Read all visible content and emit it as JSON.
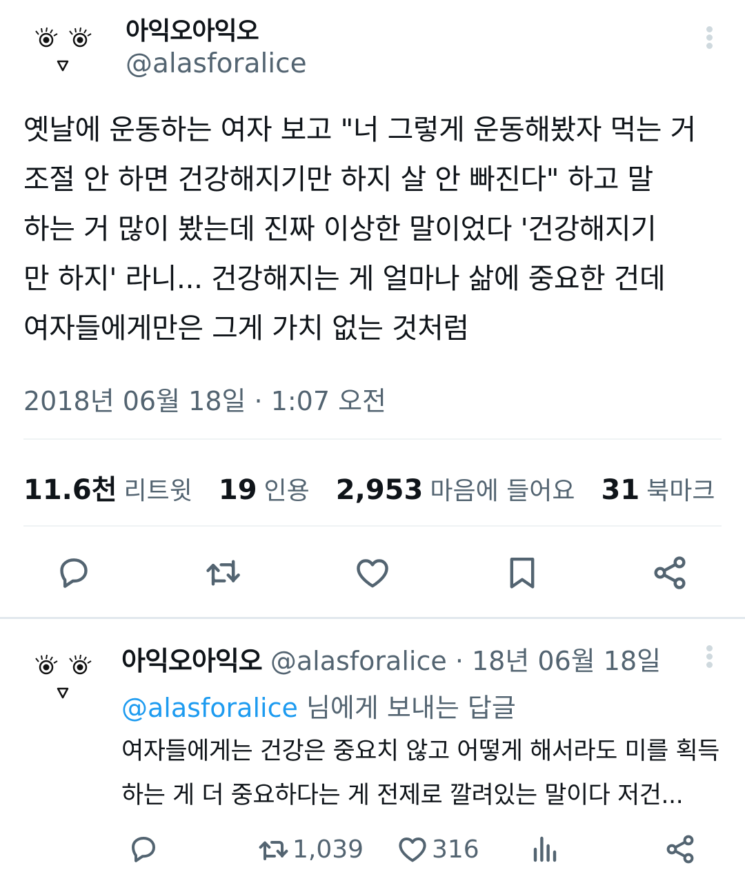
{
  "tweet": {
    "display_name": "아익오아익오",
    "handle": "@alasforalice",
    "body_lines": [
      "옛날에 운동하는 여자 보고 \"너 그렇게 운동해봤자 먹는 거",
      "조절 안 하면 건강해지기만 하지 살 안 빠진다\" 하고 말",
      "하는 거 많이 봤는데 진짜 이상한 말이었다 '건강해지기",
      "만 하지' 라니... 건강해지는 게 얼마나 삶에 중요한 건데",
      "여자들에게만은 그게 가치 없는 것처럼"
    ],
    "timestamp": "2018년 06월 18일 · 1:07 오전",
    "stats": {
      "retweets": {
        "count": "11.6천",
        "label": "리트윗"
      },
      "quotes": {
        "count": "19",
        "label": "인용"
      },
      "likes": {
        "count": "2,953",
        "label": "마음에 들어요"
      },
      "bookmarks": {
        "count": "31",
        "label": "북마크"
      }
    },
    "action_icons": [
      "reply-icon",
      "retweet-icon",
      "like-icon",
      "bookmark-icon",
      "share-icon"
    ]
  },
  "reply": {
    "display_name": "아익오아익오",
    "handle": "@alasforalice",
    "separator": "·",
    "date": "18년 06월 18일",
    "replying_to_handle": "@alasforalice",
    "replying_to_suffix": "님에게 보내는 답글",
    "body_lines": [
      "여자들에게는 건강은 중요치 않고 어떻게 해서라도 미를 획득",
      "하는 게 더 중요하다는 게 전제로 깔려있는 말이다 저건..."
    ],
    "retweet_count": "1,039",
    "like_count": "316",
    "action_icons": [
      "reply-icon",
      "retweet-icon",
      "like-icon",
      "views-icon",
      "share-icon"
    ]
  },
  "colors": {
    "text": "#0f1419",
    "secondary": "#536471",
    "link": "#1d9bf0",
    "divider": "#eff3f4"
  }
}
